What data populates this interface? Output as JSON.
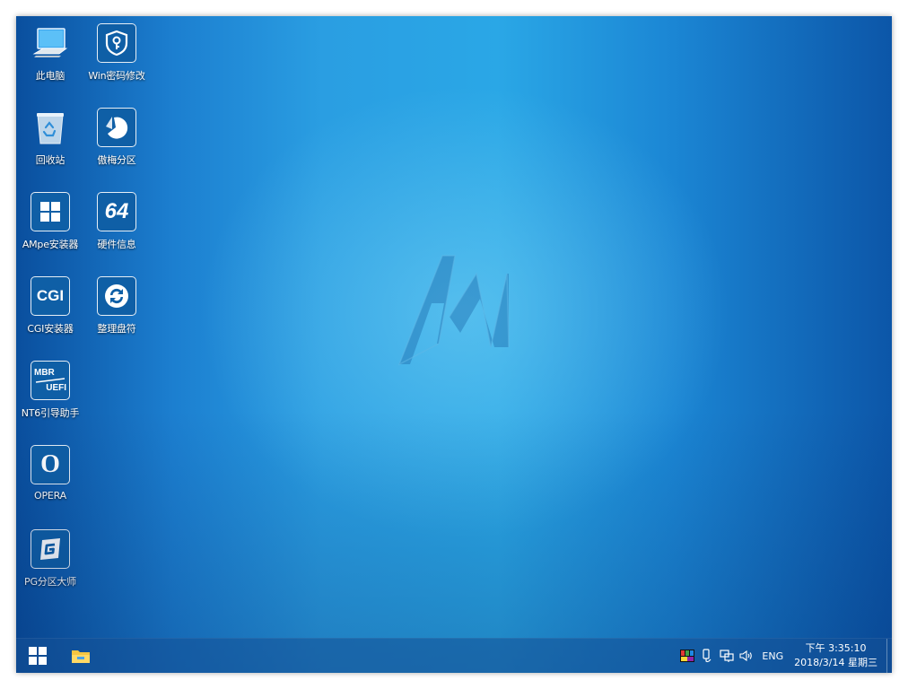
{
  "desktop": {
    "icons": [
      {
        "label": "此电脑",
        "icon": "computer-icon"
      },
      {
        "label": "Win密码修改",
        "icon": "password-key-icon"
      },
      {
        "label": "回收站",
        "icon": "recycle-bin-icon"
      },
      {
        "label": "傲梅分区",
        "icon": "aomei-partition-icon"
      },
      {
        "label": "AMpe安装器",
        "icon": "windows-installer-icon"
      },
      {
        "label": "硬件信息",
        "icon": "hardware-info-icon",
        "glyph": "64"
      },
      {
        "label": "CGI安装器",
        "icon": "cgi-installer-icon",
        "glyph": "CGI"
      },
      {
        "label": "整理盘符",
        "icon": "refresh-drive-letters-icon"
      },
      {
        "label": "NT6引导助手",
        "icon": "mbr-uefi-icon",
        "glyph_top": "MBR",
        "glyph_bottom": "UEFI"
      },
      {
        "label": "OPERA",
        "icon": "opera-icon",
        "glyph": "O"
      },
      {
        "label": "PG分区大师",
        "icon": "partition-guru-icon"
      }
    ],
    "wallpaper_logo": "AM"
  },
  "taskbar": {
    "start_icon": "windows-start-icon",
    "pinned": [
      {
        "icon": "file-explorer-icon"
      }
    ],
    "tray": {
      "icons": [
        "color-palette-icon",
        "usb-device-icon",
        "network-icon",
        "volume-icon"
      ],
      "language": "ENG",
      "time": "下午 3:35:10",
      "date": "2018/3/14 星期三"
    }
  },
  "colors": {
    "accent": "#1b86d4",
    "tile": "#0f5fa6",
    "taskbar": "#1a5a9a"
  }
}
